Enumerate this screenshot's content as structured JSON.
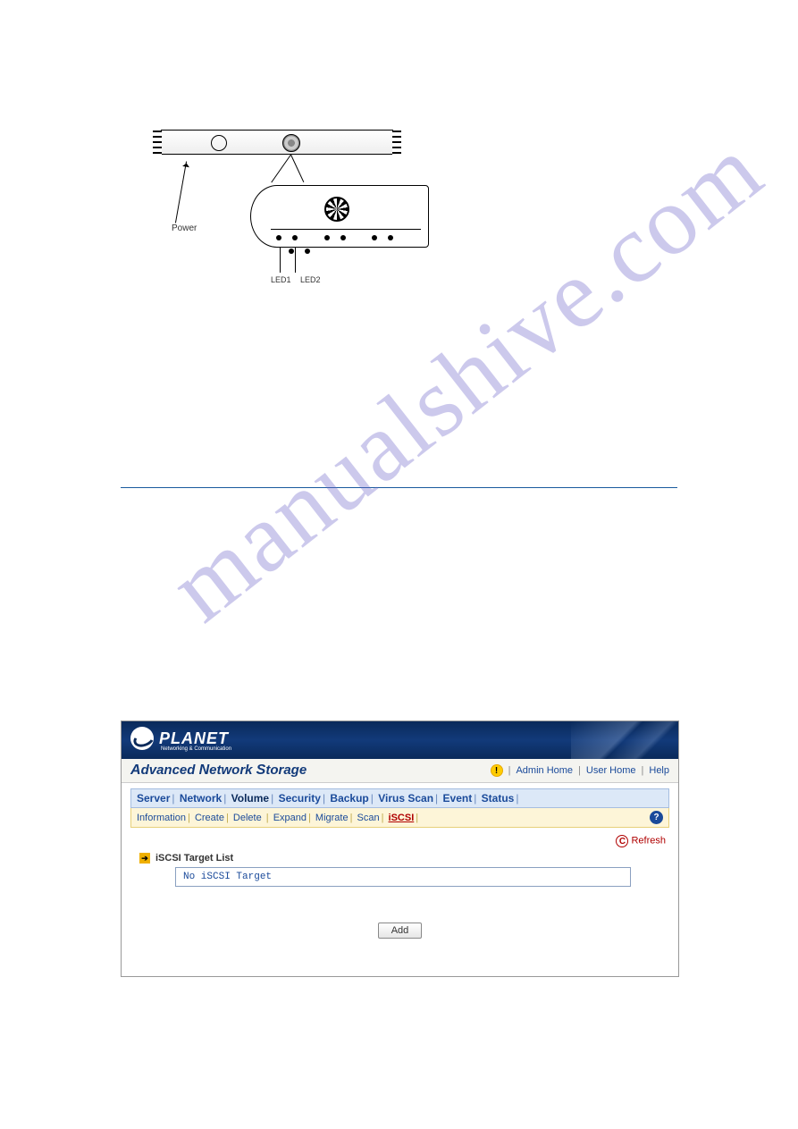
{
  "watermark": "manualshive.com",
  "diagram": {
    "power_label": "Power",
    "led1_label": "LED1",
    "led2_label": "LED2"
  },
  "ui": {
    "brand": "PLANET",
    "brand_sub": "Networking & Communication",
    "app_title_a": "A",
    "app_title_mid1": "dvanced ",
    "app_title_n": "N",
    "app_title_mid2": "etwork ",
    "app_title_s": "S",
    "app_title_end": "torage",
    "topnav": {
      "admin_home": "Admin Home",
      "user_home": "User Home",
      "help": "Help"
    },
    "main_tabs": [
      "Server",
      "Network",
      "Volume",
      "Security",
      "Backup",
      "Virus Scan",
      "Event",
      "Status"
    ],
    "sub_tabs": [
      "Information",
      "Create",
      "Delete",
      "Expand",
      "Migrate",
      "Scan",
      "iSCSI"
    ],
    "refresh": "Refresh",
    "section_title": "iSCSI Target List",
    "empty_message": "No iSCSI Target",
    "add_button": "Add"
  }
}
